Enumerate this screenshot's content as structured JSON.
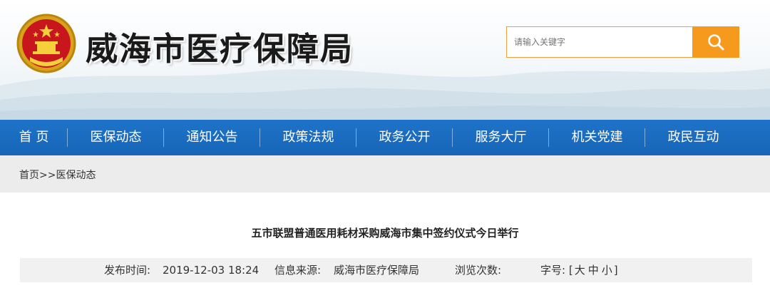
{
  "header": {
    "site_title": "威海市医疗保障局",
    "emblem_icon": "national-emblem-icon",
    "search_placeholder": "请输入关键字",
    "search_icon": "search-icon"
  },
  "colors": {
    "nav_blue": "#1a6cc2",
    "search_orange": "#f59a1c",
    "crumb_bg": "#ececec"
  },
  "nav": {
    "items": [
      "首 页",
      "医保动态",
      "通知公告",
      "政策法规",
      "政务公开",
      "服务大厅",
      "机关党建",
      "政民互动"
    ]
  },
  "breadcrumb": {
    "home": "首页",
    "separator": ">>",
    "current": "医保动态"
  },
  "article": {
    "title": "五市联盟普通医用耗材采购威海市集中签约仪式今日举行",
    "publish_label": "发布时间:",
    "publish_time": "2019-12-03 18:24",
    "source_label": "信息来源:",
    "source": "威海市医疗保障局",
    "views_label": "浏览次数:",
    "font_label": "字号:",
    "font_open": "[",
    "font_large": "大",
    "font_medium": "中",
    "font_small": "小",
    "font_close": "]"
  }
}
